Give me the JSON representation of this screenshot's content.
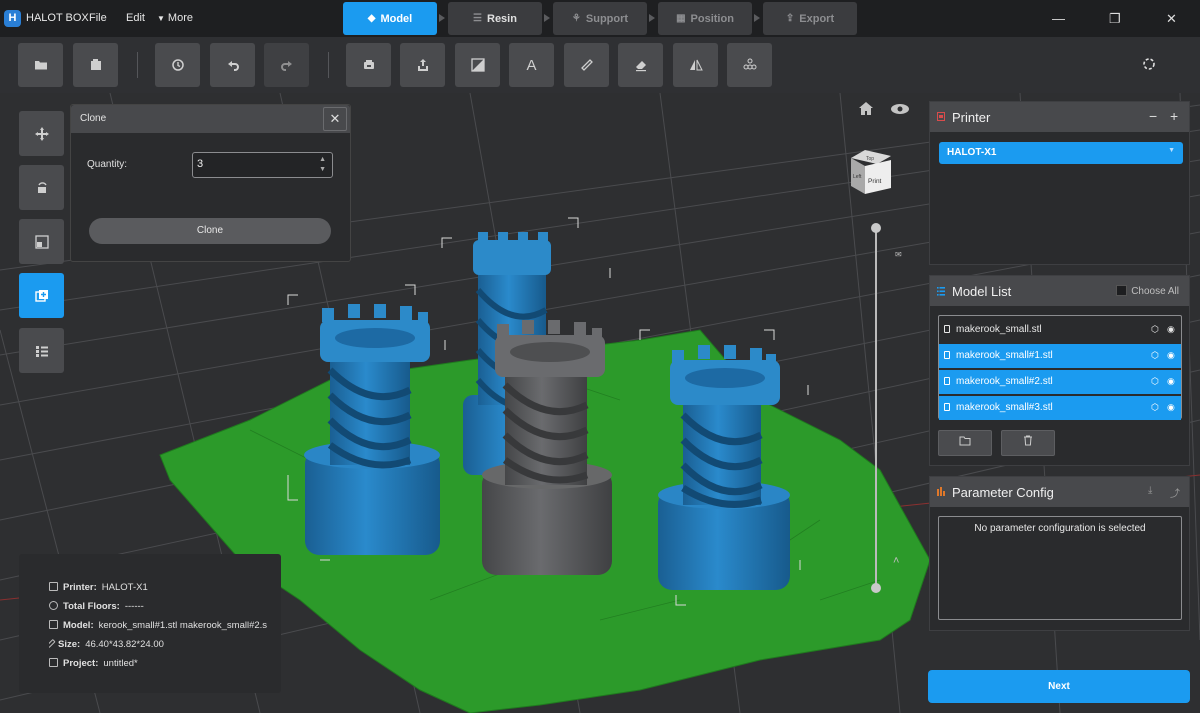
{
  "app": {
    "name": "HALOT BOX",
    "logo_letter": "H"
  },
  "menu": {
    "file": "File",
    "edit": "Edit",
    "more": "More"
  },
  "workflow_tabs": [
    {
      "label": "Model",
      "icon": "cube-icon",
      "active": true
    },
    {
      "label": "Resin",
      "icon": "sliders-icon",
      "active": false
    },
    {
      "label": "Support",
      "icon": "support-icon",
      "active": false
    },
    {
      "label": "Position",
      "icon": "grid-icon",
      "active": false
    },
    {
      "label": "Export",
      "icon": "export-icon",
      "active": false
    }
  ],
  "window_controls": {
    "minimize": "—",
    "restore": "❐",
    "close": "✕"
  },
  "toolbar": [
    "open-folder-icon",
    "import-icon",
    "reset-icon",
    "undo-icon",
    "redo-icon",
    "slice-icon",
    "export-icon",
    "hollow-icon",
    "text-icon",
    "measure-icon",
    "erase-icon",
    "mirror-icon",
    "arrange-icon",
    "settings-icon"
  ],
  "left_tools": [
    "move-icon",
    "rotate-icon",
    "scale-icon",
    "clone-icon",
    "list-icon"
  ],
  "clone_dialog": {
    "title": "Clone",
    "close": "✕",
    "quantity_label": "Quantity:",
    "quantity_value": "3",
    "button": "Clone"
  },
  "view_cube": {
    "top": "Top",
    "front": "Print",
    "left": "Left"
  },
  "info": {
    "printer_label": "Printer:",
    "printer_value": "HALOT-X1",
    "floors_label": "Total Floors:",
    "floors_value": "------",
    "model_label": "Model:",
    "model_value": "kerook_small#1.stl makerook_small#2.s",
    "size_label": "Size:",
    "size_value": "46.40*43.82*24.00",
    "project_label": "Project:",
    "project_value": "untitled*"
  },
  "printer_panel": {
    "title": "Printer",
    "minus": "−",
    "plus": "+",
    "selected": "HALOT-X1"
  },
  "model_list": {
    "title": "Model List",
    "choose_all": "Choose All",
    "items": [
      {
        "name": "makerook_small.stl",
        "selected": false
      },
      {
        "name": "makerook_small#1.stl",
        "selected": true
      },
      {
        "name": "makerook_small#2.stl",
        "selected": true
      },
      {
        "name": "makerook_small#3.stl",
        "selected": true
      }
    ]
  },
  "param_panel": {
    "title": "Parameter Config",
    "empty_text": "No parameter configuration is selected"
  },
  "next_button": "Next",
  "colors": {
    "accent": "#1b9bf0",
    "rook_blue": "#1f78b8",
    "rook_gray": "#5a5b5e",
    "plate_green": "#2c9a2a",
    "param_icon": "#e0782a",
    "printer_icon": "#d84c4c"
  }
}
